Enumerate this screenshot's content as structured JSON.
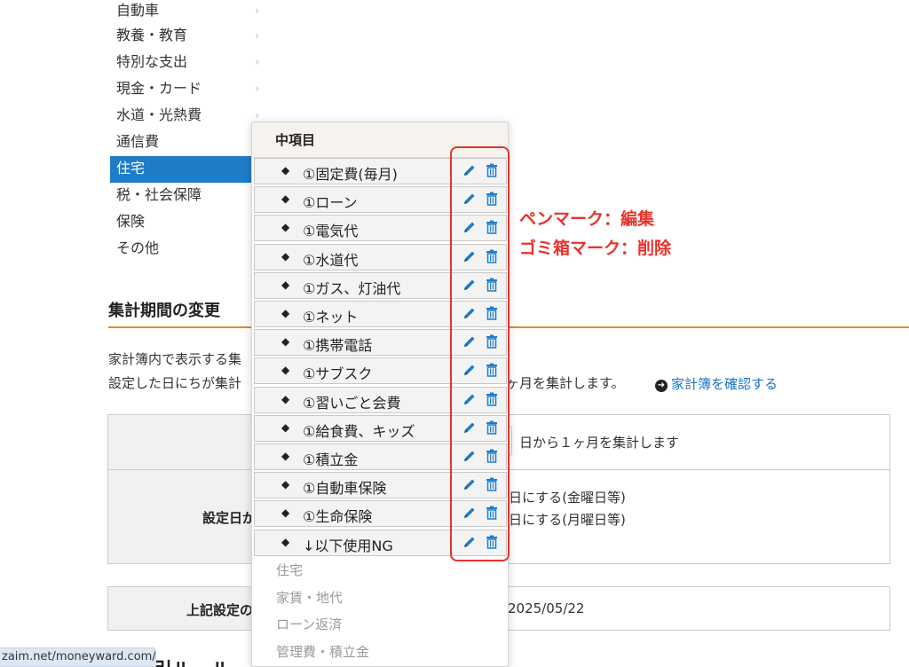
{
  "categories": [
    {
      "label": "自動車",
      "active": false,
      "chevron": true
    },
    {
      "label": "教養・教育",
      "active": false,
      "chevron": true
    },
    {
      "label": "特別な支出",
      "active": false,
      "chevron": true
    },
    {
      "label": "現金・カード",
      "active": false,
      "chevron": true
    },
    {
      "label": "水道・光熱費",
      "active": false,
      "chevron": true
    },
    {
      "label": "通信費",
      "active": false,
      "chevron": false
    },
    {
      "label": "住宅",
      "active": true,
      "chevron": false
    },
    {
      "label": "税・社会保障",
      "active": false,
      "chevron": false
    },
    {
      "label": "保険",
      "active": false,
      "chevron": false
    },
    {
      "label": "その他",
      "active": false,
      "chevron": false
    }
  ],
  "popup": {
    "header": "中項目",
    "items": [
      "①固定費(毎月)",
      "①ローン",
      "①電気代",
      "①水道代",
      "①ガス、灯油代",
      "①ネット",
      "①携帯電話",
      "①サブスク",
      "①習いごと会費",
      "①給食費、キッズ",
      "①積立金",
      "①自動車保険",
      "①生命保険",
      "↓以下使用NG"
    ],
    "gray_items": [
      "住宅",
      "家賃・地代",
      "ローン返済",
      "管理費・積立金"
    ]
  },
  "annotation": {
    "line1": "ペンマーク：編集",
    "line2": "ゴミ箱マーク：削除"
  },
  "section": {
    "title": "集計期間の変更",
    "desc1": "家計簿内で表示する集",
    "desc2": "設定した日にちが集計",
    "desc2_tail": "ヶ月を集計します。",
    "confirm_link": "家計簿を確認する"
  },
  "table": {
    "row1_text": "日から１ヶ月を集計します",
    "row2_label": "設定日が",
    "row2_opt1": "日にする(金曜日等)",
    "row2_opt2": "日にする(月曜日等)",
    "row3_label": "上記設定の",
    "row3_value": "2025/05/22"
  },
  "bottom_heading": "引ルール",
  "status_url": "zaim.net/moneyward.com/profile/rule#",
  "colors": {
    "accent_blue": "#1f7cc6",
    "annotation_red": "#e8332a",
    "section_line": "#e08a2e"
  },
  "icons": {
    "edit": "pencil-icon",
    "delete": "trash-icon",
    "drag": "drag-handle-icon",
    "link": "arrow-circle-icon"
  }
}
